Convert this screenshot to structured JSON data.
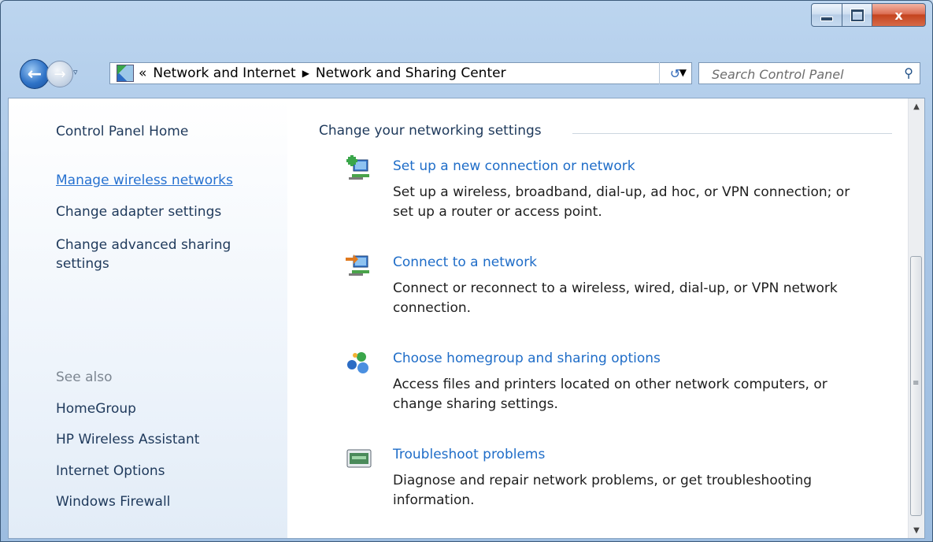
{
  "window": {
    "controls": {
      "minimize_icon": "minimize-icon",
      "maximize_icon": "maximize-icon",
      "close_label": "x"
    }
  },
  "navigation": {
    "back_icon": "back-arrow-icon",
    "forward_icon": "forward-arrow-icon",
    "address": {
      "overflow": "«",
      "crumbs": [
        "Network and Internet",
        "Network and Sharing Center"
      ]
    },
    "search": {
      "placeholder": "Search Control Panel"
    }
  },
  "sidebar": {
    "home": "Control Panel Home",
    "tasks": [
      "Manage wireless networks",
      "Change adapter settings",
      "Change advanced sharing\nsettings"
    ],
    "see_also_heading": "See also",
    "see_also": [
      "HomeGroup",
      "HP Wireless Assistant",
      "Internet Options",
      "Windows Firewall"
    ]
  },
  "main": {
    "heading": "Change your networking settings",
    "tasks": [
      {
        "title": "Set up a new connection or network",
        "description": "Set up a wireless, broadband, dial-up, ad hoc, or VPN connection; or\nset up a router or access point.",
        "icon": "new-connection-icon"
      },
      {
        "title": "Connect to a network",
        "description": "Connect or reconnect to a wireless, wired, dial-up, or VPN network\nconnection.",
        "icon": "connect-network-icon"
      },
      {
        "title": "Choose homegroup and sharing options",
        "description": "Access files and printers located on other network computers, or\nchange sharing settings.",
        "icon": "homegroup-icon"
      },
      {
        "title": "Troubleshoot problems",
        "description": "Diagnose and repair network problems, or get troubleshooting\ninformation.",
        "icon": "troubleshoot-icon"
      }
    ]
  },
  "colors": {
    "link": "#1f6dc8",
    "active_link": "#2671d0",
    "text": "#1e395b"
  }
}
